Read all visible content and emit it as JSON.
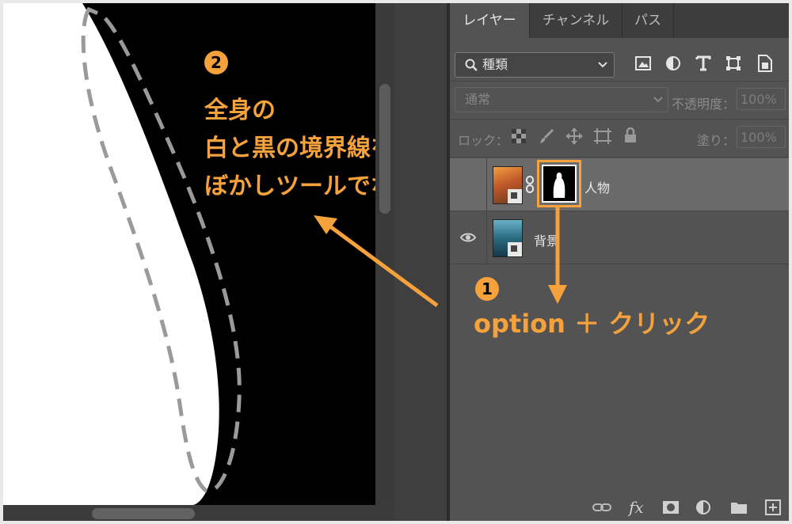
{
  "layers_panel": {
    "tabs": [
      {
        "label": "レイヤー",
        "active": true
      },
      {
        "label": "チャンネル",
        "active": false
      },
      {
        "label": "パス",
        "active": false
      }
    ],
    "filter": {
      "label": "種類"
    },
    "blend_mode": "通常",
    "opacity_label": "不透明度：",
    "opacity_value": "100%",
    "lock_label": "ロック：",
    "fill_label": "塗り：",
    "fill_value": "100%",
    "layers": [
      {
        "name": "人物",
        "selected": true,
        "visible_eye": false
      },
      {
        "name": "背景",
        "selected": false,
        "visible_eye": true
      }
    ]
  },
  "annotations": {
    "step1_number": "1",
    "step1_text": "option ＋ クリック",
    "step2_number": "2",
    "step2_lines": [
      "全身の",
      "白と黒の境界線を",
      "ぼかしツールでなぞる"
    ]
  },
  "colors": {
    "accent": "#f5a23c",
    "panel_bg": "#535353",
    "canvas_bg": "#000000",
    "dash_outline": "#9a9a9a"
  },
  "icons": [
    "search-icon",
    "chevron-down-icon",
    "image-filter-icon",
    "adjustment-filter-icon",
    "type-filter-icon",
    "shape-filter-icon",
    "smart-object-filter-icon",
    "lock-transparent-icon",
    "lock-brush-icon",
    "lock-move-icon",
    "lock-artboard-icon",
    "lock-all-icon",
    "eye-icon",
    "link-icon",
    "fx-icon",
    "mask-icon",
    "adjustment-icon",
    "folder-icon",
    "new-layer-icon"
  ]
}
